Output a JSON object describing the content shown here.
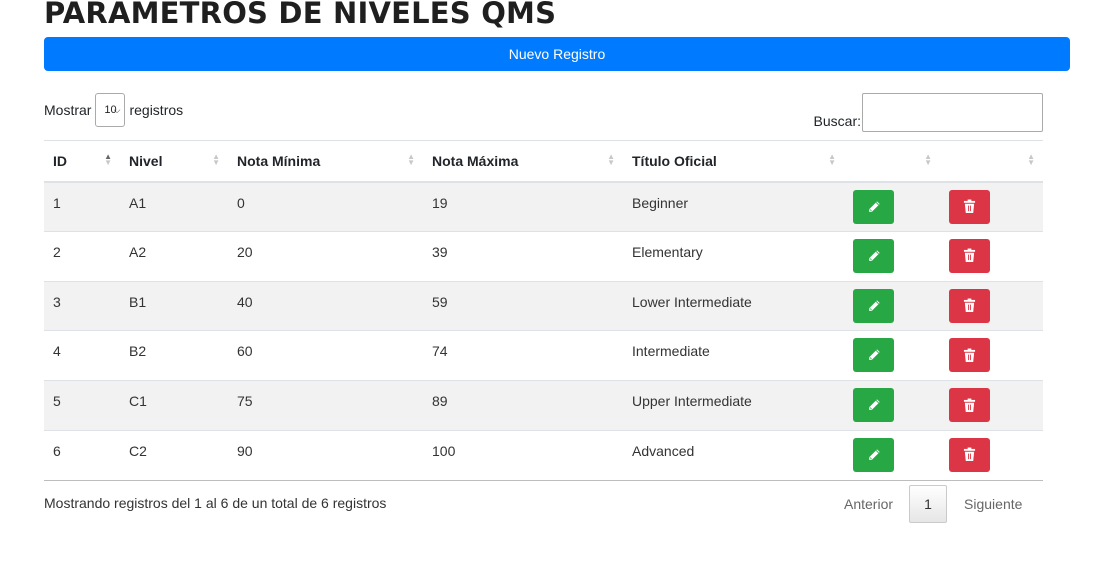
{
  "page": {
    "title": "PARAMETROS DE NIVELES QMS"
  },
  "toolbar": {
    "new_label": "Nuevo Registro"
  },
  "length": {
    "prefix": "Mostrar",
    "value": "10",
    "suffix": "registros"
  },
  "search": {
    "label": "Buscar:",
    "value": ""
  },
  "table": {
    "columns": [
      "ID",
      "Nivel",
      "Nota Mínima",
      "Nota Máxima",
      "Título Oficial",
      "",
      ""
    ],
    "sorted_column": "ID",
    "rows": [
      {
        "id": "1",
        "nivel": "A1",
        "min": "0",
        "max": "19",
        "titulo": "Beginner"
      },
      {
        "id": "2",
        "nivel": "A2",
        "min": "20",
        "max": "39",
        "titulo": "Elementary"
      },
      {
        "id": "3",
        "nivel": "B1",
        "min": "40",
        "max": "59",
        "titulo": "Lower Intermediate"
      },
      {
        "id": "4",
        "nivel": "B2",
        "min": "60",
        "max": "74",
        "titulo": "Intermediate"
      },
      {
        "id": "5",
        "nivel": "C1",
        "min": "75",
        "max": "89",
        "titulo": "Upper Intermediate"
      },
      {
        "id": "6",
        "nivel": "C2",
        "min": "90",
        "max": "100",
        "titulo": "Advanced"
      }
    ],
    "row_actions": {
      "edit_icon": "pencil-icon",
      "delete_icon": "trash-icon"
    }
  },
  "footer": {
    "info": "Mostrando registros del 1 al 6 de un total de 6 registros",
    "prev": "Anterior",
    "current_page": "1",
    "next": "Siguiente"
  },
  "colors": {
    "primary": "#007bff",
    "success": "#28a745",
    "danger": "#dc3545"
  }
}
